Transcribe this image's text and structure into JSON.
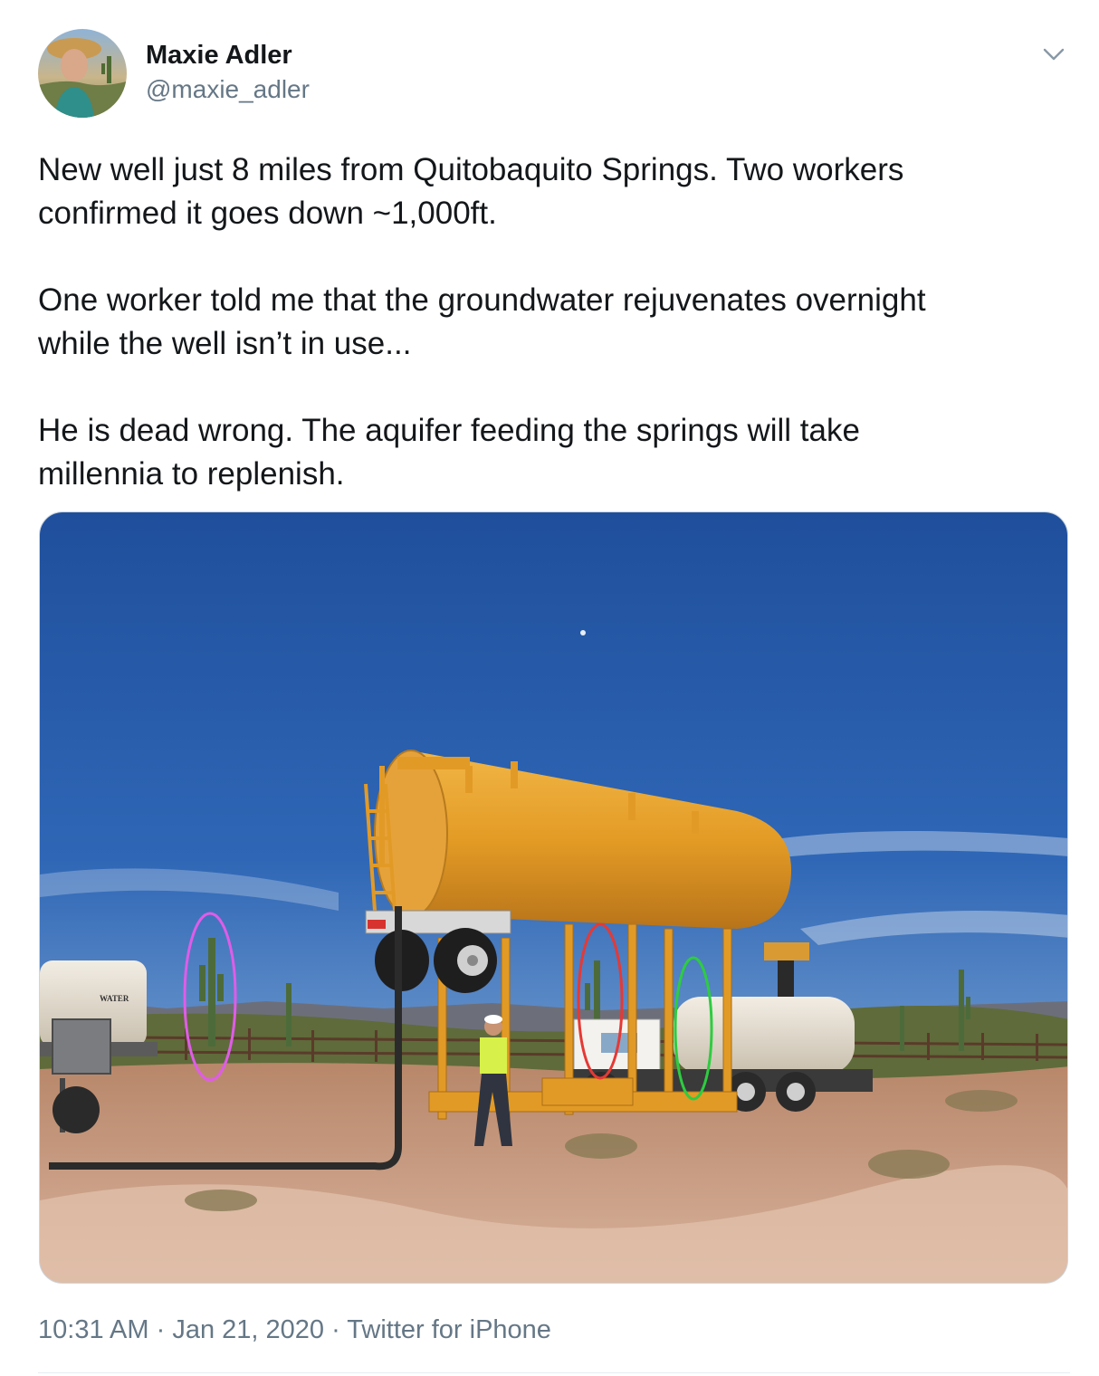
{
  "tweet": {
    "author": {
      "name": "Maxie Adler",
      "handle": "@maxie_adler"
    },
    "text": {
      "paragraph_1_line_1": "New well just 8 miles from Quitobaquito Springs. Two workers",
      "paragraph_1_line_2": "confirmed it goes down ~1,000ft.",
      "paragraph_2_line_1": "One worker told me that the groundwater rejuvenates overnight",
      "paragraph_2_line_2": "while the well isn’t in use...",
      "paragraph_3_line_1": "He is dead wrong. The aquifer feeding the springs will take",
      "paragraph_3_line_2": "millennia to replenish."
    },
    "photo": {
      "water_truck_label": "WATER",
      "annotation_colors": [
        "#e05ce8",
        "#e53935",
        "#2ecc40"
      ]
    },
    "meta": {
      "time": "10:31 AM",
      "separator_1": " · ",
      "date": "Jan 21, 2020",
      "separator_2": " · ",
      "source": "Twitter for iPhone"
    }
  },
  "colors": {
    "text_primary": "#14171a",
    "text_secondary": "#657786",
    "border": "#ccd6dd"
  },
  "icons": {
    "menu": "chevron-down-icon"
  }
}
